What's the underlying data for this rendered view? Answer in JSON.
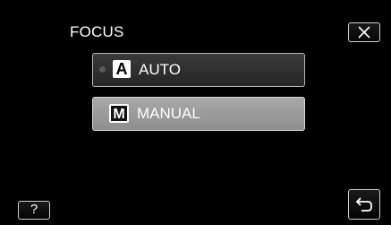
{
  "header": {
    "title": "FOCUS",
    "close_icon": "close-icon"
  },
  "options": [
    {
      "icon_letter": "A",
      "label": "AUTO",
      "selected": true
    },
    {
      "icon_letter": "M",
      "label": "MANUAL",
      "selected": false,
      "highlighted": true
    }
  ],
  "footer": {
    "help_label": "?",
    "back_icon": "back-arrow-icon"
  },
  "colors": {
    "background": "#000000",
    "text": "#ffffff",
    "button_border": "#cfcfcf",
    "option_dark": "#2e2e2e",
    "option_highlight": "#9b9b9b"
  }
}
